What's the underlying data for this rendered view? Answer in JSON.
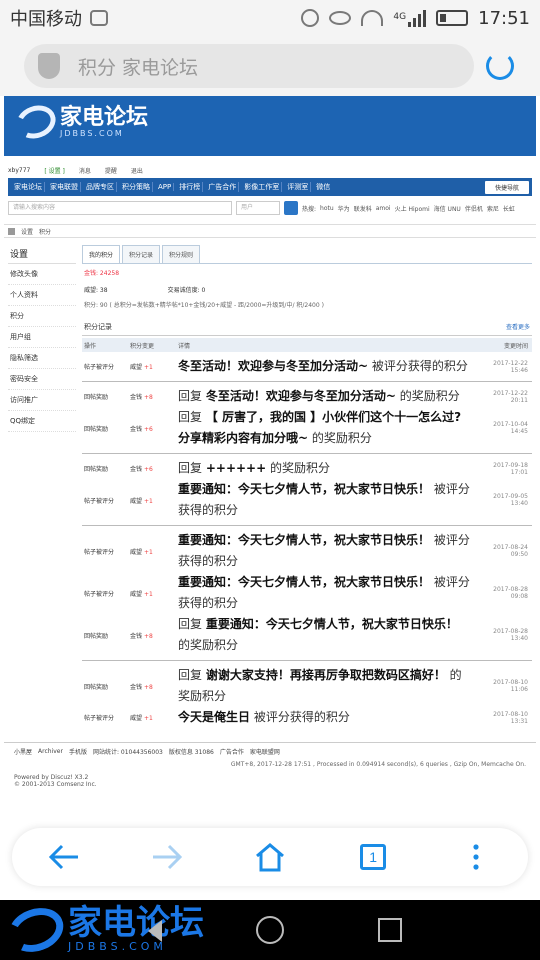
{
  "statusbar": {
    "carrier": "中国移动",
    "network": "4G",
    "time": "17:51"
  },
  "browser": {
    "url_text": "积分 家电论坛"
  },
  "site": {
    "logo_text": "家电论坛",
    "logo_sub": "JDBBS.COM",
    "userbar": [
      "xby777",
      "[ 设置 ]",
      "消息",
      "提醒",
      "退出"
    ],
    "nav": [
      "家电论坛",
      "家电联盟",
      "品牌专区",
      "积分策略",
      "APP",
      "排行榜",
      "广告合作",
      "影像工作室",
      "评测室",
      "微信"
    ],
    "quick_nav": "快捷导航",
    "search_placeholder": "请输入搜索内容",
    "search_select": "用户",
    "hot_label": "热搜:",
    "hot_items": [
      "hotu",
      "华为",
      "联发科",
      "amoi",
      "火上 Hipomi",
      "海信 UNU",
      "伴侣机",
      "索尼",
      "长虹"
    ],
    "breadcrumb": [
      "设置",
      "积分"
    ]
  },
  "sidebar": {
    "title": "设置",
    "items": [
      "修改头像",
      "个人资料",
      "积分",
      "用户组",
      "隐私筛选",
      "密码安全",
      "访问推广",
      "QQ绑定"
    ]
  },
  "main": {
    "tabs": [
      "我的积分",
      "积分记录",
      "积分规则"
    ],
    "total": "金钱: 24258",
    "summary_a": "威望: 38",
    "summary_b": "交易诚信度: 0",
    "rule": "积分: 90 ( 总积分=发帖数+精华帖*10+金钱/20+威望 - 距/2000=升级到/中/ 积/2400 )",
    "section_title": "积分记录",
    "section_more": "查看更多",
    "columns": [
      "操作",
      "积分变更",
      "详情",
      "变更时间"
    ],
    "rows": [
      {
        "op": "帖子被评分",
        "ctype": "威望",
        "cval": "+1",
        "prefix": "",
        "bold": "冬至活动！欢迎参与冬至加分活动~",
        "tail": " 被评分获得的积分",
        "time": "2017-12-22 15:46"
      },
      {
        "op": "回帖奖励",
        "ctype": "金钱",
        "cval": "+8",
        "prefix": "回复 ",
        "bold": "冬至活动！欢迎参与冬至加分活动~",
        "tail": " 的奖励积分",
        "time": "2017-12-22 20:11"
      },
      {
        "op": "回帖奖励",
        "ctype": "金钱",
        "cval": "+6",
        "prefix": "回复 ",
        "bold": "【 厉害了，我的国 】小伙伴们这个十一怎么过? 分享精彩内容有加分哦~",
        "tail": " 的奖励积分",
        "time": "2017-10-04 14:45"
      },
      {
        "op": "回帖奖励",
        "ctype": "金钱",
        "cval": "+6",
        "prefix": "回复 ",
        "bold": "++++++",
        "tail": " 的奖励积分",
        "time": "2017-09-18 17:01"
      },
      {
        "op": "帖子被评分",
        "ctype": "威望",
        "cval": "+1",
        "prefix": "",
        "bold": "重要通知：今天七夕情人节，祝大家节日快乐！",
        "tail": " 被评分获得的积分",
        "time": "2017-09-05 13:40"
      },
      {
        "op": "帖子被评分",
        "ctype": "威望",
        "cval": "+1",
        "prefix": "",
        "bold": "重要通知：今天七夕情人节，祝大家节日快乐！",
        "tail": " 被评分获得的积分",
        "time": "2017-08-24 09:50"
      },
      {
        "op": "帖子被评分",
        "ctype": "威望",
        "cval": "+1",
        "prefix": "",
        "bold": "重要通知：今天七夕情人节，祝大家节日快乐！",
        "tail": " 被评分获得的积分",
        "time": "2017-08-28 09:08"
      },
      {
        "op": "回帖奖励",
        "ctype": "金钱",
        "cval": "+8",
        "prefix": "回复 ",
        "bold": "重要通知：今天七夕情人节，祝大家节日快乐！",
        "tail": " 的奖励积分",
        "time": "2017-08-28 13:40"
      },
      {
        "op": "回帖奖励",
        "ctype": "金钱",
        "cval": "+8",
        "prefix": "回复 ",
        "bold": "谢谢大家支持！再接再厉争取把数码区搞好！",
        "tail": " 的奖励积分",
        "time": "2017-08-10 11:06"
      },
      {
        "op": "帖子被评分",
        "ctype": "威望",
        "cval": "+1",
        "prefix": "",
        "bold": "今天是俺生日",
        "tail": " 被评分获得的积分",
        "time": "2017-08-10 13:31"
      }
    ]
  },
  "footer": {
    "links": [
      "小黑屋",
      "Archiver",
      "手机版",
      "网站统计: 01044356003",
      "版权信息 31086",
      "广告合作",
      "家电联盟网"
    ],
    "line2": "GMT+8, 2017-12-28 17:51 , Processed in 0.094914 second(s), 6 queries , Gzip On, Memcache On.",
    "powered": "Powered by Discuz! X3.2",
    "copyright": "© 2001-2013 Comsenz Inc."
  },
  "bottombar": {
    "tab_count": "1"
  },
  "watermark": {
    "text": "家电论坛",
    "sub": "JDBBS.COM"
  },
  "colors": {
    "accent": "#1d64b3",
    "link": "#1a8ce6",
    "red": "#e44"
  }
}
